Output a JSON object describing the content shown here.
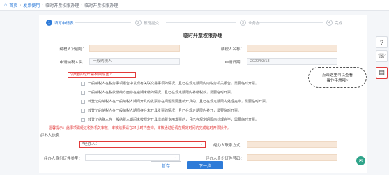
{
  "breadcrumb": {
    "home_icon": "home-icon",
    "items": [
      "首页",
      "发票使用",
      "临时开票权限办理",
      "临时开票权限办理"
    ]
  },
  "steps": [
    {
      "num": "1",
      "label": "填写申请表",
      "active": true
    },
    {
      "num": "2",
      "label": "预览提交",
      "active": false
    },
    {
      "num": "3",
      "label": "业务办",
      "active": false
    },
    {
      "num": "4",
      "label": "完成",
      "active": false
    }
  ],
  "form": {
    "title": "临时开票权限办理",
    "taxpayer_id_label": "纳税人识别号：",
    "taxpayer_name_label": "纳税人名称：",
    "applicant_type_label": "申请纳税人类：",
    "applicant_type_value": "一般纳税人",
    "apply_date_label": "申请日期：",
    "apply_date_value": "2020/03/13",
    "section_title": "*办理临时开票权限原因？",
    "options": [
      "一般纳税人在税务事项报告中发现有关联交易事项的情况，且已在规定期限内向税务机关报告，需要临时开票。",
      "一般纳税人在税款缴纳方面存在逾期未缴的情况，且已在规定期限内补缴税款，需要临时开票。",
      "转登记的纳税人在一般纳税人期间开具的发票存在问题需要重新开具的，且已在规定期限内处理完毕，需要临时开票。",
      "转登记的纳税人在一般纳税人期间存在未开具发票的情况，且已在规定期限内补开，需要临时开票。",
      "转登记纳税人在一般纳税人期间未按规定开具增值税专用发票的，且已在规定期限内处理完毕，需要临时开票。"
    ],
    "warning": "温馨提示：此事项需经过税务机关审核，审核结果请在24小时内查询，审核通过后请在规定时间内完成临时开票操作。",
    "agent_section_label": "经办人信息",
    "agent_label": "*经办人：",
    "agent_contact_label": "经办人联系方式：",
    "agent_idtype_label": "经办人身份证件类型：",
    "agent_idnum_label": "经办人身份证件号码："
  },
  "buttons": {
    "save": "暂存",
    "next": "下一步"
  },
  "callout": {
    "line1": "点击这里可以查看",
    "line2": "操作手册哦~"
  },
  "side_icons": [
    "help-icon",
    "headset-icon",
    "save-icon"
  ],
  "colors": {
    "accent": "#2e7bd8",
    "error": "#e23a3a"
  }
}
